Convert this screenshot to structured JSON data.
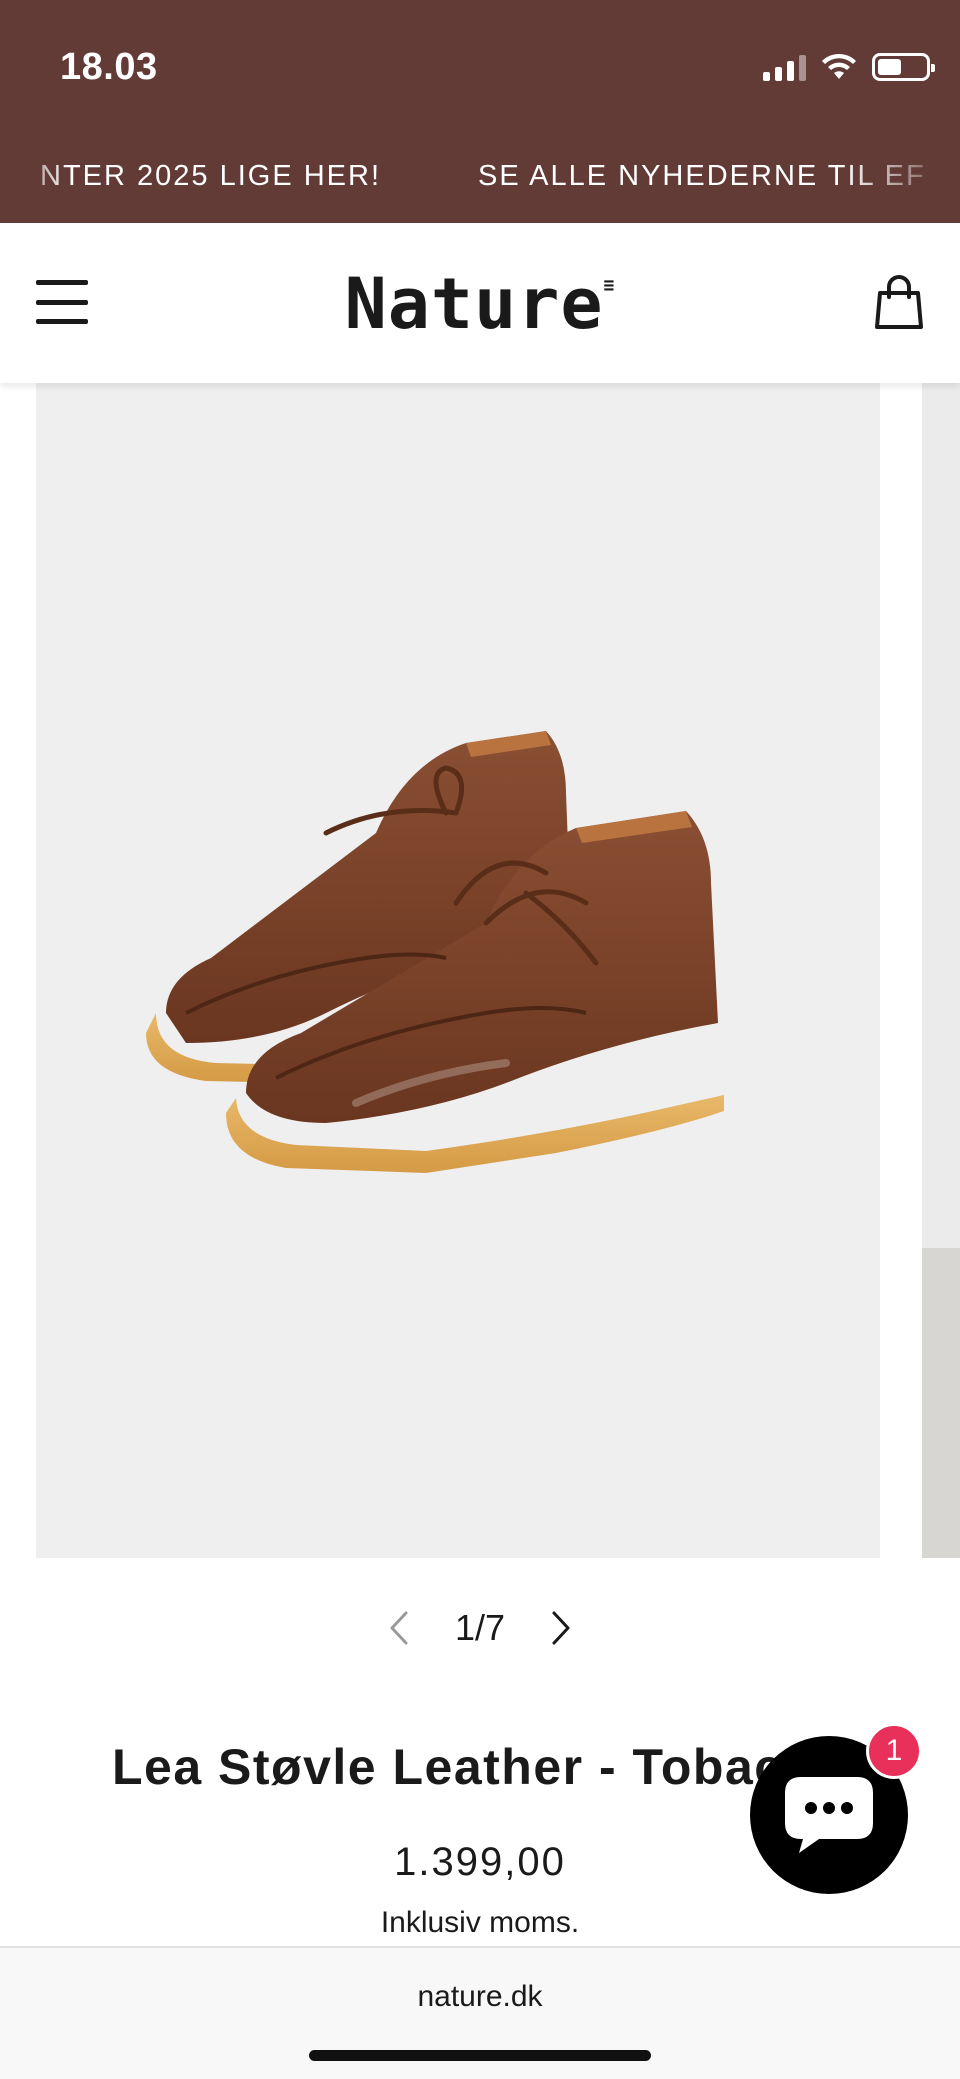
{
  "status_bar": {
    "time": "18.03",
    "icons": [
      "cellular-signal-icon",
      "wifi-icon",
      "battery-icon"
    ]
  },
  "announcement": {
    "segments": [
      "NTER 2025 LIGE HER!",
      "SE ALLE NYHEDERNE TIL EF"
    ],
    "background": "#633b36"
  },
  "header": {
    "logo_text": "Nature",
    "logo_mark": "≡",
    "menu_icon": "hamburger-menu-icon",
    "cart_icon": "shopping-bag-icon"
  },
  "gallery": {
    "image_alt": "Lea Støvle Leather - Tobacco",
    "counter": "1/7",
    "current": 1,
    "total": 7,
    "prev_icon": "chevron-left-icon",
    "next_icon": "chevron-right-icon"
  },
  "product": {
    "title": "Lea Støvle Leather - Tobac",
    "price": "1.399,00",
    "tax_note": "Inklusiv moms."
  },
  "chat": {
    "icon": "chat-bubble-icon",
    "badge_count": "1",
    "badge_color": "#e8305a"
  },
  "browser": {
    "url": "nature.dk"
  }
}
